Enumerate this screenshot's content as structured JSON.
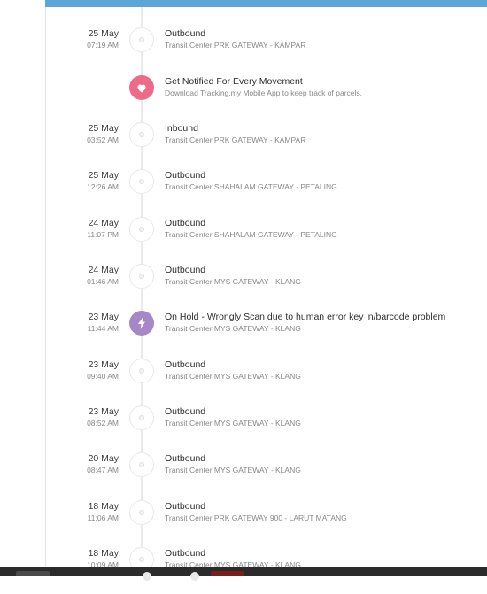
{
  "colors": {
    "accent_bar": "#5aa7d8",
    "promo_icon": "#ef6a89",
    "alert_icon": "#a687c8"
  },
  "promo": {
    "title": "Get Notified For Every Movement",
    "subtitle": "Download Tracking.my Mobile App to keep track of parcels.",
    "icon": "heart-icon"
  },
  "events": [
    {
      "date": "25 May",
      "time": "07:19 AM",
      "status": "Outbound",
      "location": "Transit Center PRK GATEWAY - KAMPAR",
      "icon": "dot"
    },
    {
      "date": "25 May",
      "time": "03:52 AM",
      "status": "Inbound",
      "location": "Transit Center PRK GATEWAY - KAMPAR",
      "icon": "dot"
    },
    {
      "date": "25 May",
      "time": "12:26 AM",
      "status": "Outbound",
      "location": "Transit Center SHAHALAM GATEWAY - PETALING",
      "icon": "dot"
    },
    {
      "date": "24 May",
      "time": "11:07 PM",
      "status": "Outbound",
      "location": "Transit Center SHAHALAM GATEWAY - PETALING",
      "icon": "dot"
    },
    {
      "date": "24 May",
      "time": "01:46 AM",
      "status": "Outbound",
      "location": "Transit Center MYS GATEWAY - KLANG",
      "icon": "dot"
    },
    {
      "date": "23 May",
      "time": "11:44 AM",
      "status": "On Hold - Wrongly Scan due to human error key in/barcode problem",
      "location": "Transit Center MYS GATEWAY - KLANG",
      "icon": "lightning-icon"
    },
    {
      "date": "23 May",
      "time": "09:40 AM",
      "status": "Outbound",
      "location": "Transit Center MYS GATEWAY - KLANG",
      "icon": "dot"
    },
    {
      "date": "23 May",
      "time": "08:52 AM",
      "status": "Outbound",
      "location": "Transit Center MYS GATEWAY - KLANG",
      "icon": "dot"
    },
    {
      "date": "20 May",
      "time": "08:47 AM",
      "status": "Outbound",
      "location": "Transit Center MYS GATEWAY - KLANG",
      "icon": "dot"
    },
    {
      "date": "18 May",
      "time": "11:06 AM",
      "status": "Outbound",
      "location": "Transit Center PRK GATEWAY 900 - LARUT MATANG",
      "icon": "dot"
    },
    {
      "date": "18 May",
      "time": "10:09 AM",
      "status": "Outbound",
      "location": "Transit Center MYS GATEWAY - KLANG",
      "icon": "dot"
    }
  ]
}
